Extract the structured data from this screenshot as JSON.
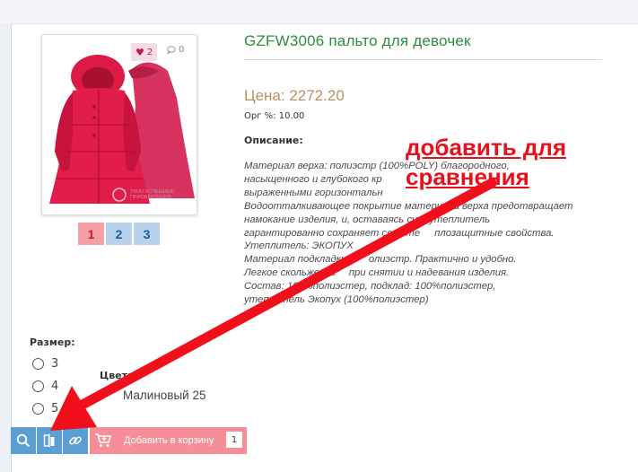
{
  "product": {
    "title": "GZFW3006 пальто для девочек",
    "price": "Цена: 2272.20",
    "org_percent": "Орг %: 10.00",
    "description_label": "Описание:",
    "description_lines": [
      "Материал верха: полиэстр (100%POLY) благородного,",
      "насыщенного и глубокого кр",
      "выраженными горизонтальн",
      "Водоотталкивающее покрытие материала верха предотвращает",
      "намокание изделия, и, оставаясь сух",
      "гарантированно сохраняет свои те",
      "Утеплитель: ЭКОПУХ",
      "Материал подкладки: п",
      "Легкое скольжение",
      "Состав: 100%полиэстер, подклад: 100%полиэстер,",
      "утеплитель Экопух (100%полиэстер)"
    ],
    "description_tails": [
      "",
      "",
      "",
      "",
      "утеплитель",
      "плозащитные свойства.",
      "",
      "олиэстр. Практично и удобно.",
      "при снятии и надевания изделия.",
      "",
      ""
    ]
  },
  "likes": {
    "count": "2"
  },
  "comments": {
    "count": "0"
  },
  "photo_caption": "ТВОИ УСПЕШНЫЕ ПРИОБРЕТЕНИЯ",
  "pagination": {
    "pages": [
      "1",
      "2",
      "3"
    ],
    "active": "1"
  },
  "annotation": {
    "line1": "добавить для",
    "line2": "сравнения"
  },
  "sizes": {
    "label": "Размер:",
    "options": [
      "3",
      "4",
      "5"
    ]
  },
  "color": {
    "label": "Цвет:",
    "value": "Малиновый 25"
  },
  "toolbar": {
    "icons": [
      "search-icon",
      "compare-icon",
      "link-icon",
      "cart-add-icon"
    ],
    "add_to_cart_label": "Добавить в корзину",
    "quantity": "1"
  },
  "colors": {
    "accent_red": "#e8101c",
    "title_green": "#2e8b3e",
    "price_tan": "#b89060",
    "button_blue": "#5b9ed2",
    "cart_pink": "#f48e98"
  }
}
